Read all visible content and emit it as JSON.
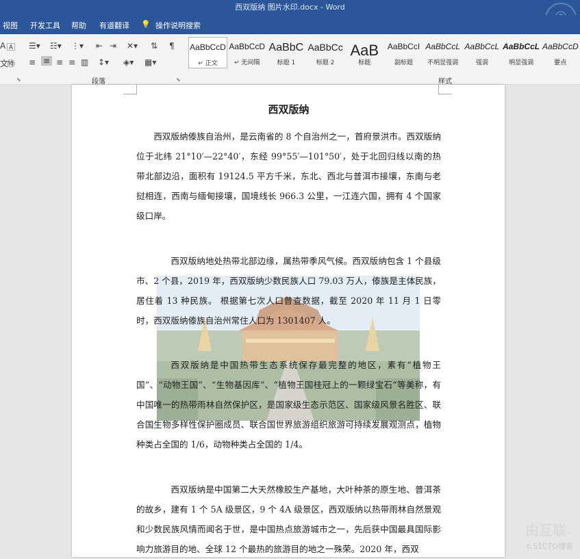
{
  "window": {
    "title": "西双版纳 图片水印.docx  -  Word"
  },
  "menu": {
    "items": [
      "视图",
      "开发工具",
      "帮助",
      "有道翻译",
      "操作说明搜索"
    ]
  },
  "ribbon": {
    "paragraph_group_label": "段落",
    "styles_group_label": "样式",
    "styles": [
      {
        "sample": "AaBbCcD",
        "name": "↵ 正文",
        "size": 12
      },
      {
        "sample": "AaBbCcD",
        "name": "↵ 无间隔",
        "size": 12
      },
      {
        "sample": "AaBbC",
        "name": "标题 1",
        "size": 16
      },
      {
        "sample": "AaBbCc",
        "name": "标题 2",
        "size": 14
      },
      {
        "sample": "AaB",
        "name": "标题",
        "size": 22
      },
      {
        "sample": "AaBbCcI",
        "name": "副标题",
        "size": 12
      },
      {
        "sample": "AaBbCcL",
        "name": "不明显强调",
        "size": 12
      },
      {
        "sample": "AaBbCcL",
        "name": "强调",
        "size": 12
      },
      {
        "sample": "AaBbCcL",
        "name": "明显强调",
        "size": 12
      },
      {
        "sample": "AaBbCcD",
        "name": "要点",
        "size": 12
      }
    ]
  },
  "document": {
    "title": "西双版纳",
    "paragraphs": [
      "西双版纳傣族自治州，是云南省的 8 个自治州之一，首府景洪市。西双版纳位于北纬 21°10′—22°40′，东经 99°55′—101°50′，处于北回归线以南的热带北部边沿，面积有 19124.5 平方千米，东北、西北与普洱市接壤，东南与老挝相连，西南与缅甸接壤，国境线长 966.3 公里，一江连六国，拥有 4 个国家级口岸。",
      "西双版纳地处热带北部边缘，属热带季风气候。西双版纳包含 1 个县级市、2 个县，2019 年，西双版纳少数民族人口 79.03 万人，傣族是主体民族，居住着 13 种民族。  根据第七次人口普查数据，截至 2020 年 11 月 1 日零时，西双版纳傣族自治州常住人口为 1301407 人。",
      "西双版纳是中国热带生态系统保存最完整的地区，素有“植物王国”、“动物王国”、“生物基因库”、“植物王国桂冠上的一颗绿宝石”等美称，有中国唯一的热带雨林自然保护区，是国家级生态示范区、国家级风景名胜区、联合国生物多样性保护圈成员、联合国世界旅游组织旅游可持续发展观测点，植物种类占全国的 1/6，动物种类占全国的 1/4。",
      "西双版纳是中国第二大天然橡胶生产基地，大叶种茶的原生地、普洱茶的故乡，建有 1 个 5A 级景区，9 个 4A 级景区，西双版纳以热带雨林自然景观和少数民族风情而闻名于世，是中国热点旅游城市之一，先后获中国最具国际影响力旅游目的地、全球 12 个最热的旅游目的地之一殊荣。2020 年，西双"
    ]
  },
  "overlay": {
    "brand": "©51CTO博客",
    "brand2": "由互联"
  }
}
